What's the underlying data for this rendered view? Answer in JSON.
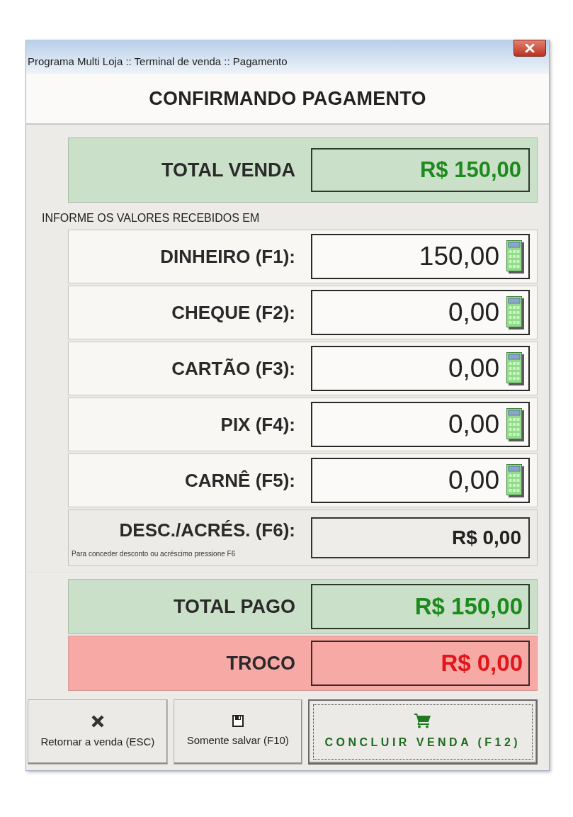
{
  "window": {
    "title": "Programa Multi Loja :: Terminal de venda :: Pagamento"
  },
  "header": {
    "title": "CONFIRMANDO PAGAMENTO"
  },
  "total_sale": {
    "label": "TOTAL VENDA",
    "value": "R$ 150,00"
  },
  "payments": {
    "heading": "INFORME OS VALORES RECEBIDOS EM",
    "methods": [
      {
        "label": "DINHEIRO (F1):",
        "value": "150,00"
      },
      {
        "label": "CHEQUE (F2):",
        "value": "0,00"
      },
      {
        "label": "CARTÃO (F3):",
        "value": "0,00"
      },
      {
        "label": "PIX (F4):",
        "value": "0,00"
      },
      {
        "label": "CARNÊ (F5):",
        "value": "0,00"
      }
    ],
    "adjustment": {
      "label": "DESC./ACRÉS. (F6):",
      "hint": "Para conceder desconto ou acréscimo pressione F6",
      "value": "R$ 0,00"
    }
  },
  "totals": [
    {
      "kind": "paid",
      "label": "TOTAL PAGO",
      "value": "R$ 150,00"
    },
    {
      "kind": "change",
      "label": "TROCO",
      "value": "R$ 0,00"
    }
  ],
  "buttons": [
    {
      "kind": "back",
      "label": "Retornar a venda (ESC)",
      "focused": false
    },
    {
      "kind": "save",
      "label": "Somente salvar (F10)",
      "focused": false
    },
    {
      "kind": "confirm",
      "label": "CONCLUIR VENDA (F12)",
      "focused": true
    }
  ]
}
